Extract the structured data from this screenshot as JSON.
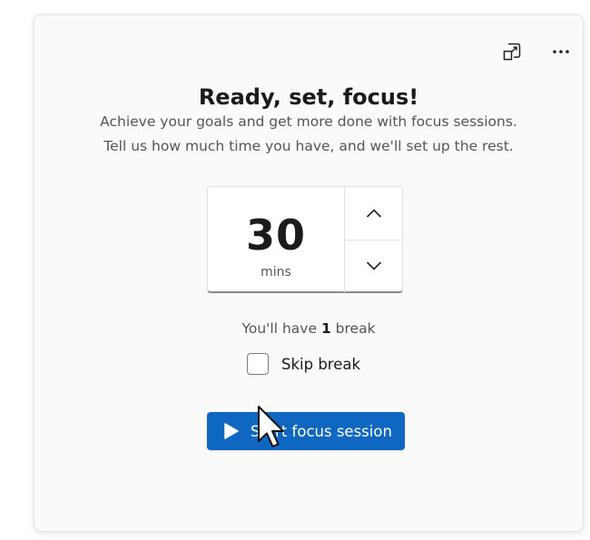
{
  "toolbar": {
    "compact_icon": "pop-out-icon",
    "more_icon": "more-options-icon"
  },
  "heading": {
    "title": "Ready, set, focus!",
    "line1": "Achieve your goals and get more done with focus sessions.",
    "line2": "Tell us how much time you have, and we'll set up the rest."
  },
  "timer": {
    "value": "30",
    "unit": "mins",
    "up_icon": "chevron-up-icon",
    "down_icon": "chevron-down-icon"
  },
  "breaks": {
    "prefix": "You'll have ",
    "count": "1",
    "suffix": " break",
    "skip_label": "Skip break",
    "skip_checked": false
  },
  "start": {
    "label": "Start focus session",
    "icon": "play-icon"
  },
  "colors": {
    "accent": "#0f67c2",
    "card_bg": "#fafafa"
  }
}
